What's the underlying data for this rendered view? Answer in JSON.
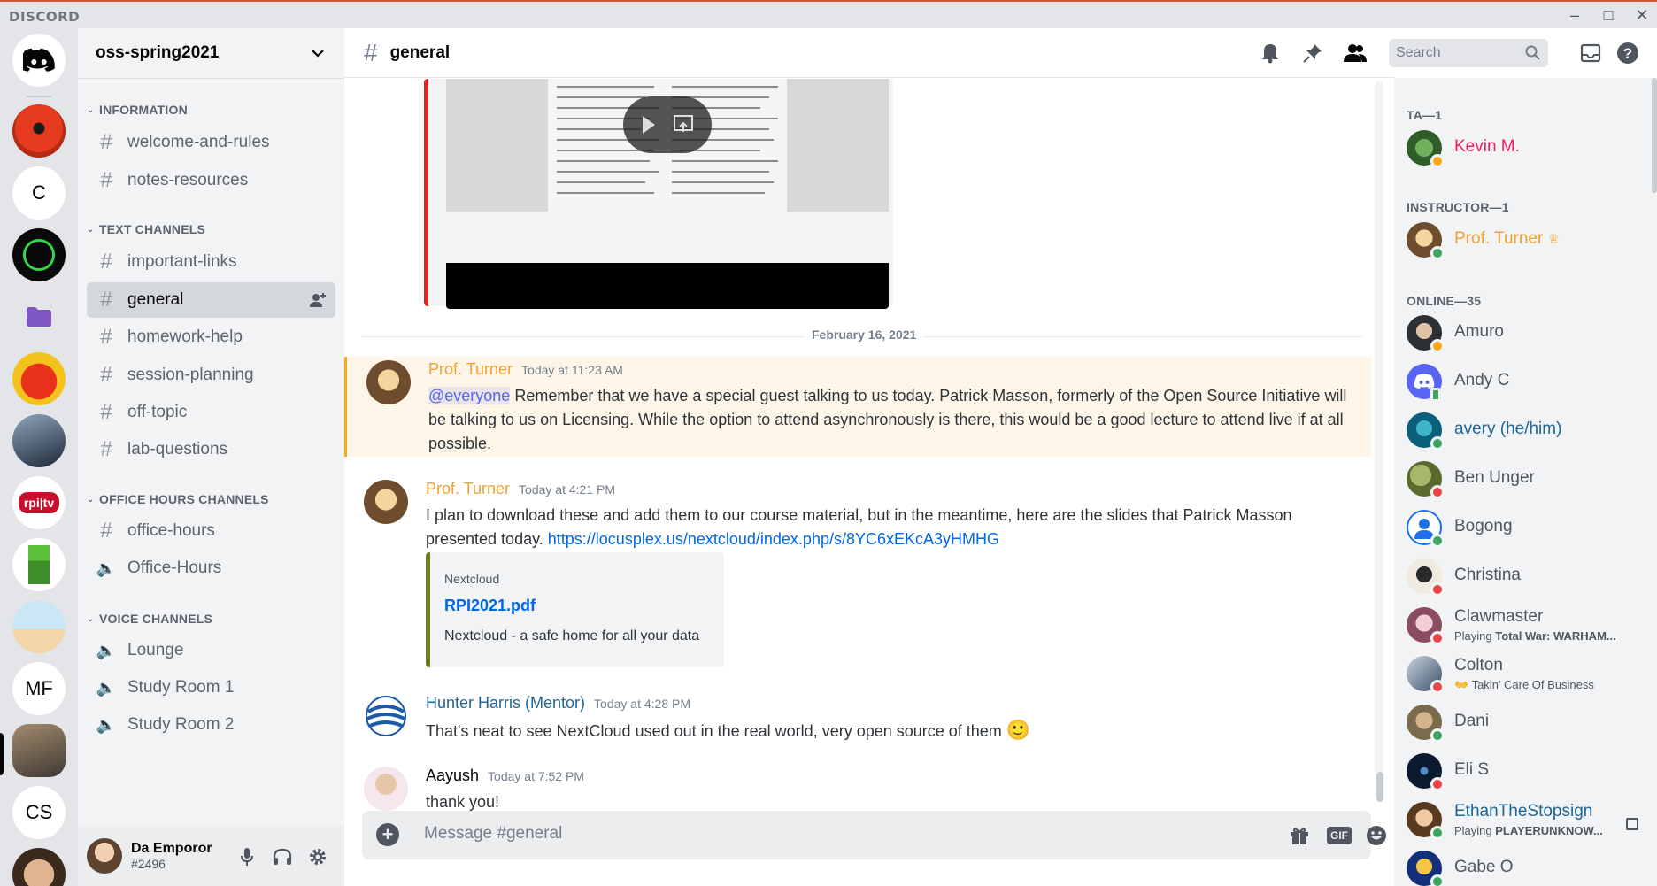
{
  "app": {
    "brand": "DISCORD"
  },
  "servers": [
    {
      "name": "home",
      "label": ""
    },
    {
      "name": "server-red",
      "label": ""
    },
    {
      "name": "server-c",
      "label": "C"
    },
    {
      "name": "server-green",
      "label": ""
    },
    {
      "name": "server-folder",
      "label": ""
    },
    {
      "name": "server-apple",
      "label": ""
    },
    {
      "name": "server-photo",
      "label": ""
    },
    {
      "name": "server-rpitv",
      "label": "rpi|tv"
    },
    {
      "name": "server-creeper",
      "label": ""
    },
    {
      "name": "server-desk",
      "label": ""
    },
    {
      "name": "server-mf",
      "label": "MF"
    },
    {
      "name": "server-room",
      "label": ""
    },
    {
      "name": "server-cs",
      "label": "CS"
    },
    {
      "name": "server-face",
      "label": ""
    }
  ],
  "sidebar": {
    "guild_name": "oss-spring2021",
    "categories": [
      {
        "label": "INFORMATION"
      },
      {
        "label": "TEXT CHANNELS"
      },
      {
        "label": "OFFICE HOURS CHANNELS"
      },
      {
        "label": "VOICE CHANNELS"
      }
    ],
    "channels": [
      {
        "label": "welcome-and-rules"
      },
      {
        "label": "notes-resources"
      },
      {
        "label": "important-links"
      },
      {
        "label": "general"
      },
      {
        "label": "homework-help"
      },
      {
        "label": "session-planning"
      },
      {
        "label": "off-topic"
      },
      {
        "label": "lab-questions"
      },
      {
        "label": "office-hours"
      },
      {
        "label": "Office-Hours"
      },
      {
        "label": "Lounge"
      },
      {
        "label": "Study Room 1"
      },
      {
        "label": "Study Room 2"
      }
    ],
    "user": {
      "name": "Da Emporor",
      "tag": "#2496"
    }
  },
  "chat": {
    "channel": "general",
    "search_placeholder": "Search",
    "date_divider": "February 16, 2021",
    "messages": [
      {
        "author": "Prof. Turner",
        "author_color": "#f0a232",
        "timestamp": "Today at 11:23 AM",
        "mention": "@everyone",
        "text": " Remember that we have a special guest talking to us today. Patrick Masson, formerly of the Open Source Initiative will be talking to us on Licensing. While the option to attend asynchronously is there, this would be a good lecture to attend live if at all possible."
      },
      {
        "author": "Prof. Turner",
        "author_color": "#f0a232",
        "timestamp": "Today at 4:21 PM",
        "text": "I plan to download these and add them to our course material, but in the meantime, here are the slides that Patrick Masson presented today. ",
        "link": "https://locusplex.us/nextcloud/index.php/s/8YC6xEKcA3yHMHG",
        "embed": {
          "provider": "Nextcloud",
          "title": "RPI2021.pdf",
          "description": "Nextcloud - a safe home for all your data"
        }
      },
      {
        "author": "Hunter Harris (Mentor)",
        "author_color": "#206694",
        "timestamp": "Today at 4:28 PM",
        "text": "That's neat to see NextCloud used out in the real world, very open source of them",
        "emoji": "🙂"
      },
      {
        "author": "Aayush",
        "author_color": "#060607",
        "timestamp": "Today at 7:52 PM",
        "text": "thank you!"
      }
    ],
    "composer_placeholder": "Message #general",
    "gif_label": "GIF"
  },
  "members": {
    "groups": [
      {
        "label": "TA—1"
      },
      {
        "label": "INSTRUCTOR—1"
      },
      {
        "label": "ONLINE—35"
      }
    ],
    "list": [
      {
        "name": "Kevin M.",
        "color": "#e91e63",
        "activity": ""
      },
      {
        "name": "Prof. Turner",
        "color": "#f0a232",
        "activity": ""
      },
      {
        "name": "Amuro",
        "color": "#4f5660",
        "activity": ""
      },
      {
        "name": "Andy C",
        "color": "#4f5660",
        "activity": ""
      },
      {
        "name": "avery (he/him)",
        "color": "#206694",
        "activity": ""
      },
      {
        "name": "Ben Unger",
        "color": "#4f5660",
        "activity": ""
      },
      {
        "name": "Bogong",
        "color": "#4f5660",
        "activity": ""
      },
      {
        "name": "Christina",
        "color": "#4f5660",
        "activity": ""
      },
      {
        "name": "Clawmaster",
        "color": "#4f5660",
        "activity_prefix": "Playing ",
        "activity": "Total War: WARHAM..."
      },
      {
        "name": "Colton",
        "color": "#4f5660",
        "activity_prefix": "",
        "activity": "Takin' Care Of Business"
      },
      {
        "name": "Dani",
        "color": "#4f5660",
        "activity": ""
      },
      {
        "name": "Eli S",
        "color": "#4f5660",
        "activity": ""
      },
      {
        "name": "EthanTheStopsign",
        "color": "#206694",
        "activity_prefix": "Playing ",
        "activity": "PLAYERUNKNOW..."
      },
      {
        "name": "Gabe O",
        "color": "#4f5660",
        "activity": ""
      }
    ]
  }
}
